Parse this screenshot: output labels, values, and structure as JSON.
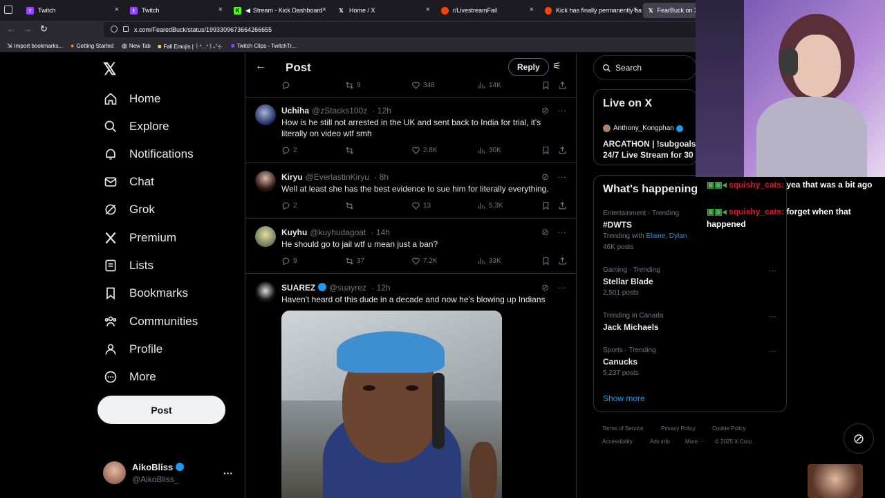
{
  "browser": {
    "tabs": [
      {
        "title": "Twitch",
        "icon": "twitch-icon",
        "color": "#9146ff"
      },
      {
        "title": "Twitch",
        "icon": "twitch-icon",
        "color": "#9146ff"
      },
      {
        "title": "Stream - Kick Dashboard",
        "icon": "kick-icon",
        "color": "#53fc18"
      },
      {
        "title": "Home / X",
        "icon": "x-logo-icon",
        "color": "#ffffff"
      },
      {
        "title": "r/LivestreamFail",
        "icon": "reddit-icon",
        "color": "#ff4500"
      },
      {
        "title": "Kick has finally permanently ba",
        "icon": "reddit-icon",
        "color": "#ff4500"
      },
      {
        "title": "FearBuck on X:",
        "icon": "x-logo-icon",
        "color": "#ffffff"
      }
    ],
    "url": "x.com/FearedBuck/status/1993309673664266655",
    "bookmarks": [
      "Import bookmarks...",
      "Getting Started",
      "New Tab",
      "Fall Emojis | ꒰ᐢ. .ᐢ꒱₊˚⊹",
      "Twitch Clips - TwitchTr..."
    ]
  },
  "sidebar": {
    "items": [
      {
        "label": "Home",
        "icon": "home-icon"
      },
      {
        "label": "Explore",
        "icon": "search-icon"
      },
      {
        "label": "Notifications",
        "icon": "bell-icon"
      },
      {
        "label": "Chat",
        "icon": "mail-icon"
      },
      {
        "label": "Grok",
        "icon": "grok-icon"
      },
      {
        "label": "Premium",
        "icon": "x-logo-icon"
      },
      {
        "label": "Lists",
        "icon": "list-icon"
      },
      {
        "label": "Bookmarks",
        "icon": "bookmark-icon"
      },
      {
        "label": "Communities",
        "icon": "communities-icon"
      },
      {
        "label": "Profile",
        "icon": "person-icon"
      },
      {
        "label": "More",
        "icon": "more-circle-icon"
      }
    ],
    "post_label": "Post",
    "account": {
      "name": "AikoBliss",
      "handle": "@AikoBliss_"
    }
  },
  "header": {
    "title": "Post",
    "reply_label": "Reply"
  },
  "top_actions": {
    "retweets": "9",
    "likes": "348",
    "views": "14K"
  },
  "tweets": [
    {
      "name": "Uchiha",
      "handle": "@zStacks100z",
      "time": "· 12h",
      "text": "How is he still not arrested in the UK and sent back to India for trial, it's literally on video wtf smh",
      "replies": "2",
      "retweets": "",
      "likes": "2.8K",
      "views": "30K"
    },
    {
      "name": "Kiryu",
      "handle": "@EverlastinKiryu",
      "time": "· 8h",
      "text": "Well at least she has the best evidence to sue him for literally everything.",
      "replies": "2",
      "retweets": "",
      "likes": "13",
      "views": "5.3K"
    },
    {
      "name": "Kuyhu",
      "handle": "@kuyhudagoat",
      "time": "· 14h",
      "text": "He should go to jail wtf u mean just a ban?",
      "replies": "9",
      "retweets": "37",
      "likes": "7.2K",
      "views": "33K"
    },
    {
      "name": "SUAREZ",
      "handle": "@suayrez",
      "time": "· 12h",
      "text": "Haven't heard of this dude in a decade and now he's blowing up Indians",
      "replies": "",
      "retweets": "",
      "likes": "",
      "views": ""
    }
  ],
  "right": {
    "search_placeholder": "Search",
    "live_title": "Live on X",
    "live_host": "Anthony_Kongphan",
    "live_stream": "ARCATHON | !subgoals 24/7 Live Stream for 30",
    "trends_title": "What's happening",
    "trends": [
      {
        "context": "Entertainment · Trending",
        "name": "#DWTS",
        "extra_prefix": "Trending with",
        "extra_links": "Elaine, Dylan",
        "posts": "46K posts"
      },
      {
        "context": "Gaming · Trending",
        "name": "Stellar Blade",
        "posts": "2,501 posts"
      },
      {
        "context": "Trending in Canada",
        "name": "Jack Michaels",
        "posts": ""
      },
      {
        "context": "Sports · Trending",
        "name": "Canucks",
        "posts": "5,237 posts"
      }
    ],
    "show_more": "Show more",
    "footer": [
      "Terms of Service",
      "Privacy Policy",
      "Cookie Policy",
      "Accessibility",
      "Ads info",
      "More ···",
      "© 2025 X Corp."
    ]
  },
  "overlay_chat": [
    {
      "user": "squishy_cats:",
      "message": "yea that was a bit ago"
    },
    {
      "user": "squishy_cats:",
      "message": "forget when that happened"
    }
  ],
  "colors": {
    "accent": "#1d9bf0",
    "chat_user": "#e8112d",
    "border": "#2f3336"
  }
}
